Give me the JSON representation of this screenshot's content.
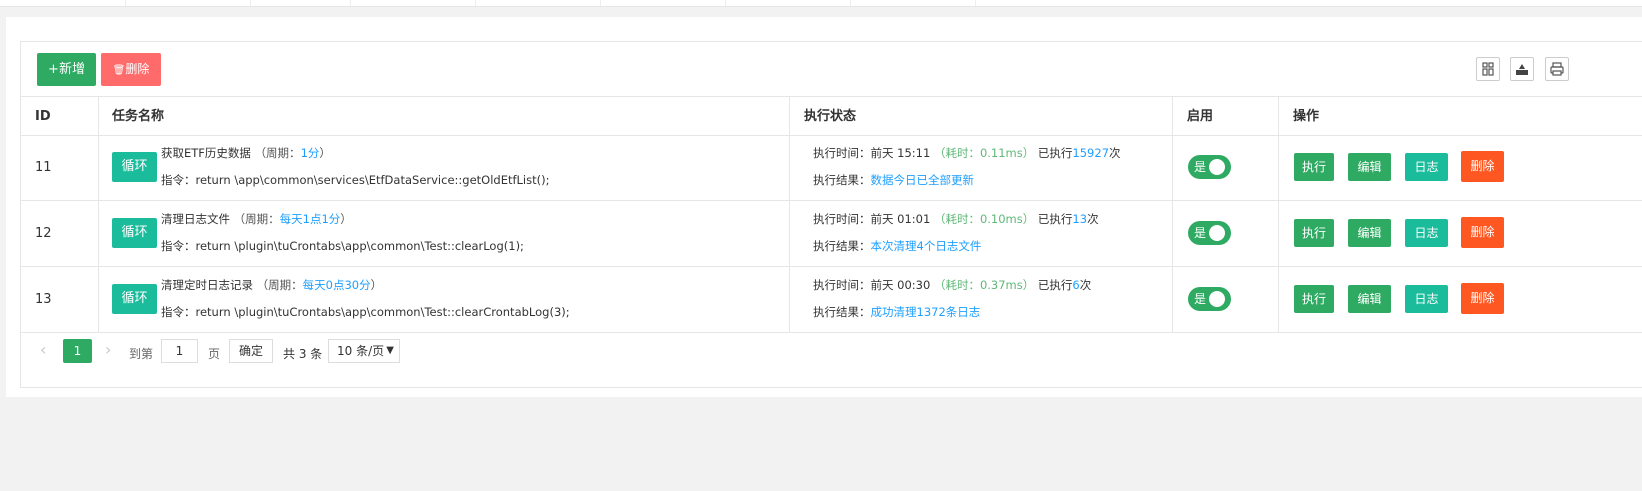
{
  "toolbar": {
    "add_label": "+新增",
    "delete_label": "删除",
    "tools": [
      "columns-icon",
      "export-icon",
      "print-icon"
    ]
  },
  "table": {
    "headers": [
      "ID",
      "任务名称",
      "执行状态",
      "启用",
      "操作"
    ],
    "rows": [
      {
        "id": "11",
        "tag": "循环",
        "name": "获取ETF历史数据",
        "period_prefix": "（周期：",
        "period": "1分",
        "period_suffix": "）",
        "cmd_label": "指令：",
        "cmd": "return \\app\\common\\services\\EtfDataService::getOldEtfList();",
        "time_label": "执行时间：",
        "time": "前天 15:11",
        "duration": "（耗时：0.11ms）",
        "count_prefix": "已执行",
        "count": "15927",
        "count_suffix": "次",
        "result_label": "执行结果：",
        "result": "数据今日已全部更新",
        "enabled_label": "是"
      },
      {
        "id": "12",
        "tag": "循环",
        "name": "清理日志文件",
        "period_prefix": "（周期：",
        "period": "每天1点1分",
        "period_suffix": "）",
        "cmd_label": "指令：",
        "cmd": "return \\plugin\\tuCrontabs\\app\\common\\Test::clearLog(1);",
        "time_label": "执行时间：",
        "time": "前天 01:01",
        "duration": "（耗时：0.10ms）",
        "count_prefix": "已执行",
        "count": "13",
        "count_suffix": "次",
        "result_label": "执行结果：",
        "result": "本次清理4个日志文件",
        "enabled_label": "是"
      },
      {
        "id": "13",
        "tag": "循环",
        "name": "清理定时日志记录",
        "period_prefix": "（周期：",
        "period": "每天0点30分",
        "period_suffix": "）",
        "cmd_label": "指令：",
        "cmd": "return \\plugin\\tuCrontabs\\app\\common\\Test::clearCrontabLog(3);",
        "time_label": "执行时间：",
        "time": "前天 00:30",
        "duration": "（耗时：0.37ms）",
        "count_prefix": "已执行",
        "count": "6",
        "count_suffix": "次",
        "result_label": "执行结果：",
        "result": "成功清理1372条日志",
        "enabled_label": "是"
      }
    ],
    "actions": {
      "exec": "执行",
      "edit": "编辑",
      "log": "日志",
      "delete": "删除"
    }
  },
  "pager": {
    "current_page": "1",
    "goto_label": "到第",
    "page_input": "1",
    "page_unit": "页",
    "confirm_label": "确定",
    "total_label": "共 3 条",
    "page_size": "10 条/页"
  },
  "colors": {
    "primary_green": "#2eaa63",
    "teal": "#1bbc9b",
    "danger": "#ff5722",
    "soft_danger": "#ff6b6b",
    "link_blue": "#1e9fff"
  }
}
